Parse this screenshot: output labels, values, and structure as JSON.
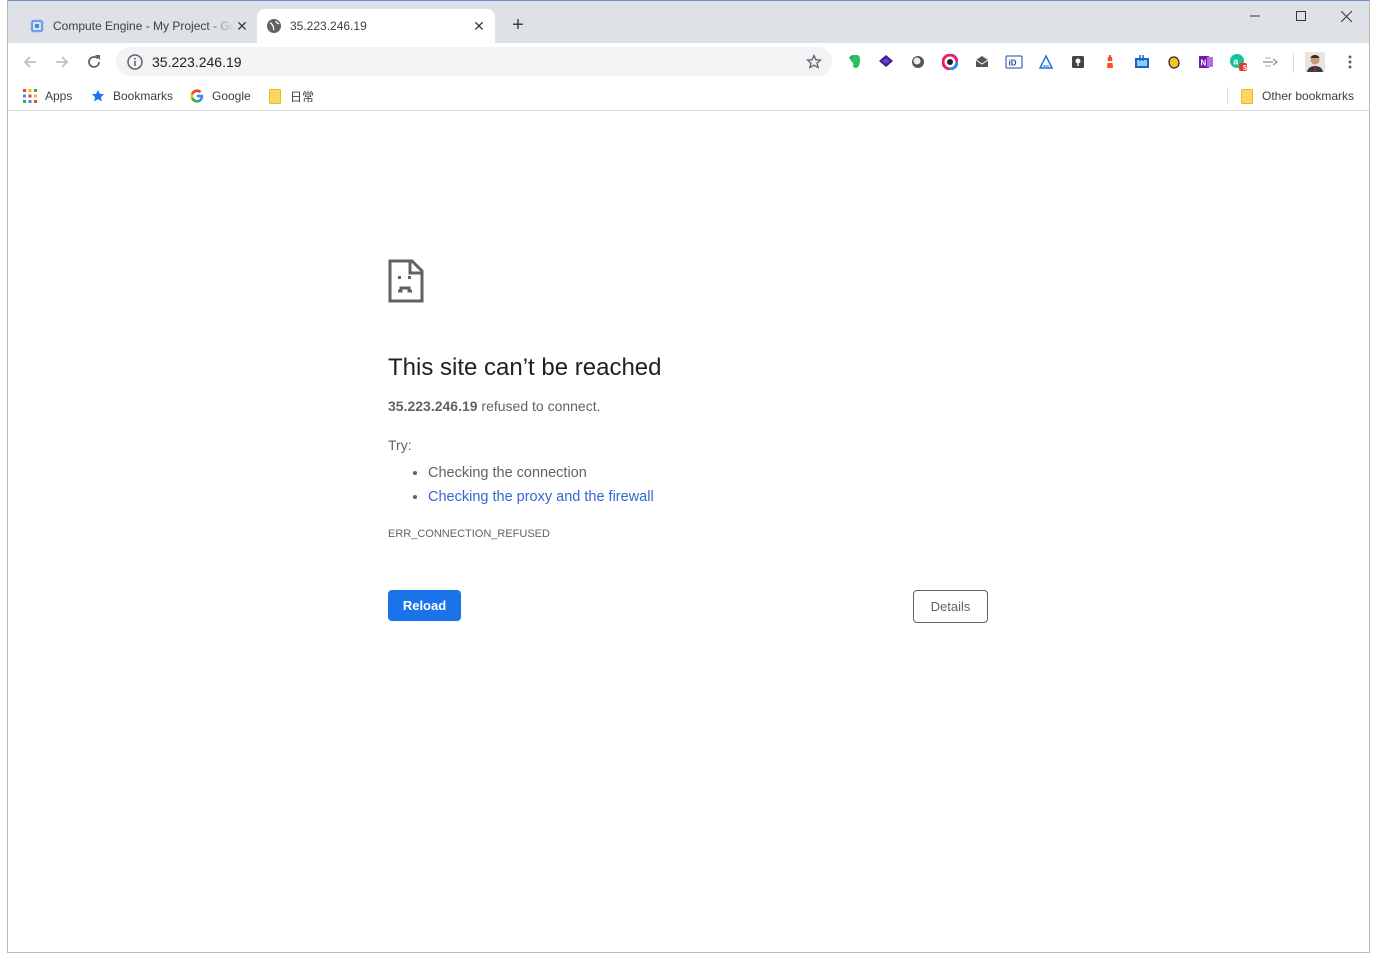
{
  "tabs": [
    {
      "title": "Compute Engine - My Project - Google Cloud Platform",
      "active": false,
      "favicon": "compute-engine-icon"
    },
    {
      "title": "35.223.246.19",
      "active": true,
      "favicon": "globe-icon"
    }
  ],
  "omnibox": {
    "url": "35.223.246.19"
  },
  "bookmarks": {
    "apps": "Apps",
    "bookmarks": "Bookmarks",
    "google": "Google",
    "folder": "日常",
    "other": "Other bookmarks"
  },
  "extension_badge": "5",
  "error": {
    "title": "This site can’t be reached",
    "host": "35.223.246.19",
    "message": "refused to connect.",
    "try_label": "Try:",
    "suggestions": [
      "Checking the connection",
      "Checking the proxy and the firewall"
    ],
    "code": "ERR_CONNECTION_REFUSED",
    "reload_label": "Reload",
    "details_label": "Details"
  },
  "colors": {
    "accent": "#1a73e8",
    "link": "#3367d6",
    "text": "#5f6368",
    "heading": "#202124"
  }
}
